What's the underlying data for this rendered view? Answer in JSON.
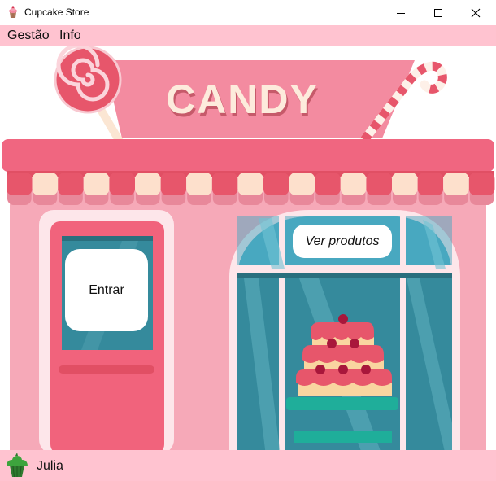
{
  "window": {
    "title": "Cupcake Store"
  },
  "menu": {
    "items": [
      "Gestão",
      "Info"
    ]
  },
  "storefront": {
    "sign_text": "CANDY",
    "enter_button_label": "Entrar",
    "products_button_label": "Ver produtos"
  },
  "status": {
    "user_name": "Julia"
  },
  "icons": {
    "app": "cupcake-icon",
    "user": "cupcake-icon",
    "minimize": "minimize-icon",
    "maximize": "maximize-icon",
    "close": "close-icon"
  },
  "colors": {
    "menubar_bg": "#ffc3d0",
    "shop_wall": "#f6a9b8",
    "awning": "#f06680",
    "window_glass": "#358a9c"
  }
}
